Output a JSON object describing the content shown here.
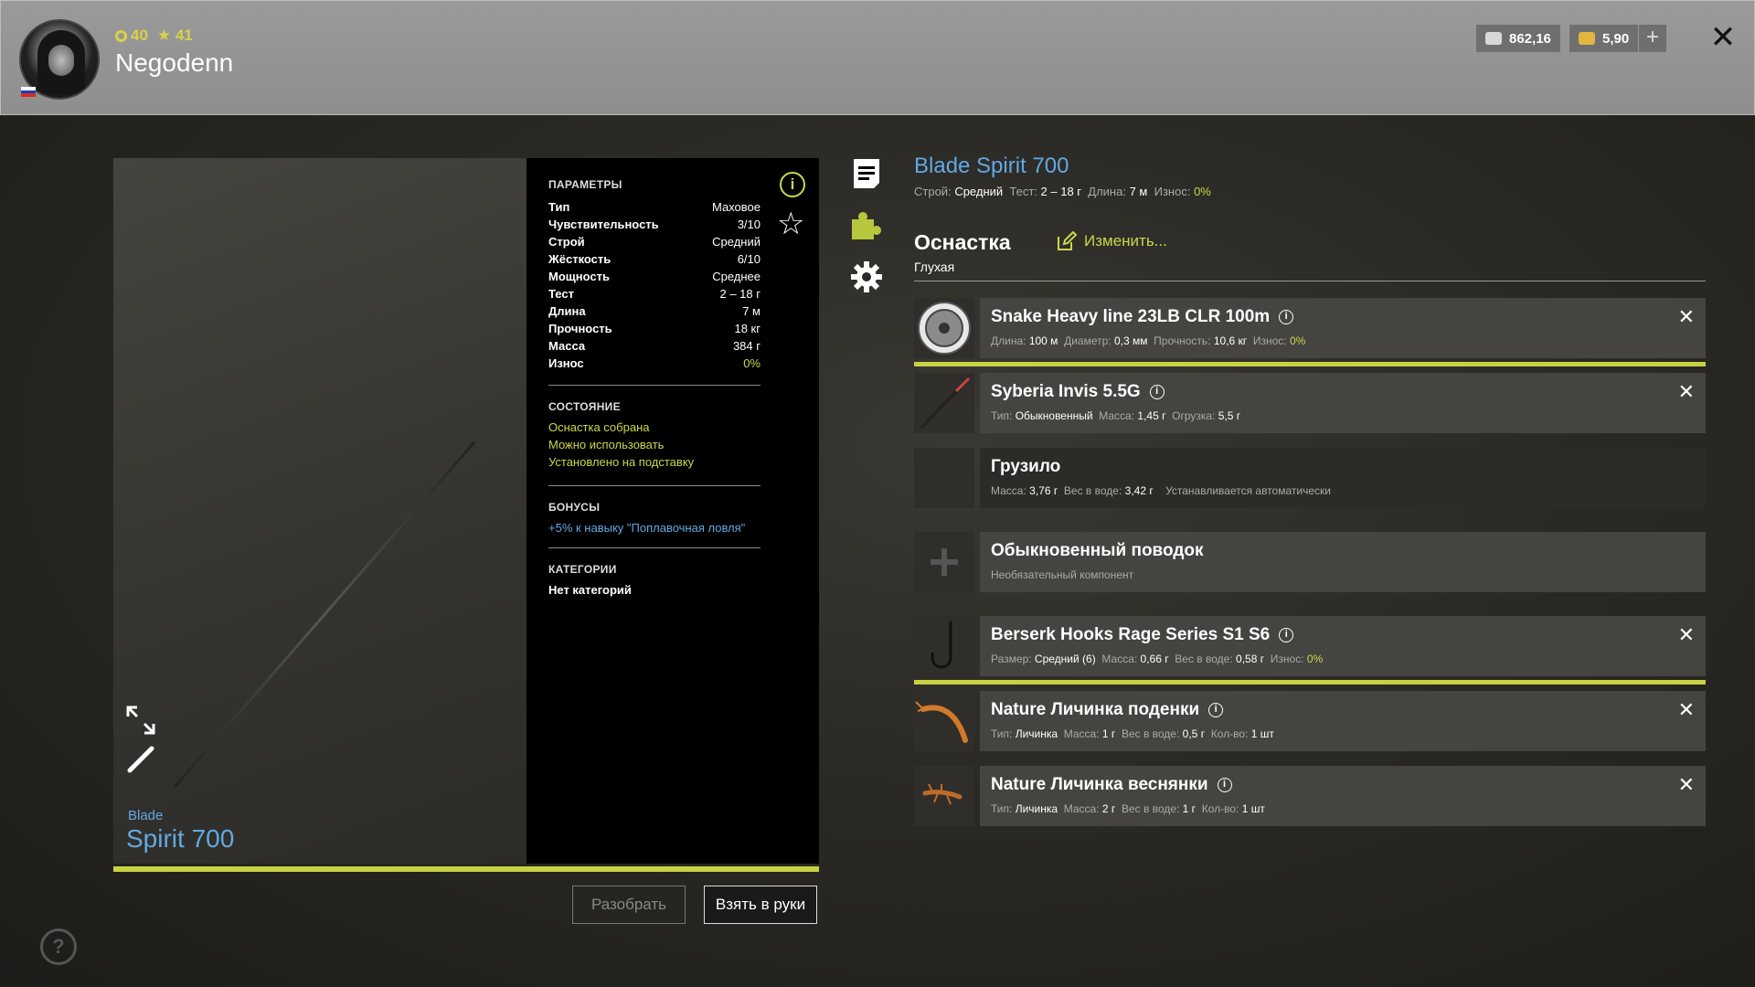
{
  "player": {
    "level": "40",
    "rank": "41",
    "name": "Negodenn"
  },
  "currency": {
    "silver": "862,16",
    "gold": "5,90",
    "plus": "+"
  },
  "close_glyph": "✕",
  "rod_preview": {
    "brand": "Blade",
    "model": "Spirit 700"
  },
  "params": {
    "title": "ПАРАМЕТРЫ",
    "rows": [
      {
        "k": "Тип",
        "v": "Маховое"
      },
      {
        "k": "Чувствительность",
        "v": "3/10"
      },
      {
        "k": "Строй",
        "v": "Средний"
      },
      {
        "k": "Жёсткость",
        "v": "6/10"
      },
      {
        "k": "Мощность",
        "v": "Среднее"
      },
      {
        "k": "Тест",
        "v": "2 – 18 г"
      },
      {
        "k": "Длина",
        "v": "7 м"
      },
      {
        "k": "Прочность",
        "v": "18 кг"
      },
      {
        "k": "Масса",
        "v": "384 г"
      },
      {
        "k": "Износ",
        "v": "0%"
      }
    ],
    "state_title": "СОСТОЯНИЕ",
    "state_lines": [
      "Оснастка собрана",
      "Можно использовать",
      "Установлено на подставку"
    ],
    "bonus_title": "БОНУСЫ",
    "bonus_line": "+5% к навыку \"Поплавочная ловля\"",
    "cat_title": "КАТЕГОРИИ",
    "cat_line": "Нет категорий",
    "info_glyph": "i",
    "star_glyph": "☆"
  },
  "buttons": {
    "disassemble": "Разобрать",
    "take": "Взять в руки"
  },
  "rod_info": {
    "title": "Blade Spirit 700",
    "build_label": "Строй:",
    "build": "Средний",
    "test_label": "Тест:",
    "test": "2 – 18 г",
    "length_label": "Длина:",
    "length": "7 м",
    "wear_label": "Износ:",
    "wear": "0%"
  },
  "tackle": {
    "title": "Оснастка",
    "type": "Глухая",
    "edit": "Изменить..."
  },
  "items": [
    {
      "name": "Snake Heavy line 23LB CLR 100m",
      "desc": [
        [
          "Длина:",
          "100 м"
        ],
        [
          "Диаметр:",
          "0,3 мм"
        ],
        [
          "Прочность:",
          "10,6 кг"
        ],
        [
          "Износ:",
          "0%"
        ]
      ]
    },
    {
      "name": "Syberia Invis 5.5G",
      "desc": [
        [
          "Тип:",
          "Обыкновенный"
        ],
        [
          "Масса:",
          "1,45 г"
        ],
        [
          "Огрузка:",
          "5,5 г"
        ]
      ]
    },
    {
      "name": "Грузило",
      "desc": [
        [
          "Масса:",
          "3,76 г"
        ],
        [
          "Вес в воде:",
          "3,42 г"
        ]
      ],
      "extra": "Устанавливается автоматически"
    },
    {
      "name": "Обыкновенный поводок",
      "plain": "Необязательный компонент"
    },
    {
      "name": "Berserk Hooks Rage Series S1 S6",
      "desc": [
        [
          "Размер:",
          "Средний (6)"
        ],
        [
          "Масса:",
          "0,66 г"
        ],
        [
          "Вес в воде:",
          "0,58 г"
        ],
        [
          "Износ:",
          "0%"
        ]
      ]
    },
    {
      "name": "Nature Личинка поденки",
      "desc": [
        [
          "Тип:",
          "Личинка"
        ],
        [
          "Масса:",
          "1 г"
        ],
        [
          "Вес в воде:",
          "0,5 г"
        ],
        [
          "Кол-во:",
          "1 шт"
        ]
      ]
    },
    {
      "name": "Nature Личинка веснянки",
      "desc": [
        [
          "Тип:",
          "Личинка"
        ],
        [
          "Масса:",
          "2 г"
        ],
        [
          "Вес в воде:",
          "1 г"
        ],
        [
          "Кол-во:",
          "1 шт"
        ]
      ]
    }
  ],
  "item_close": "✕",
  "item_info": "i",
  "help_glyph": "?",
  "colors": {
    "accent_green": "#cdd64b",
    "accent_blue": "#62a8e3"
  }
}
